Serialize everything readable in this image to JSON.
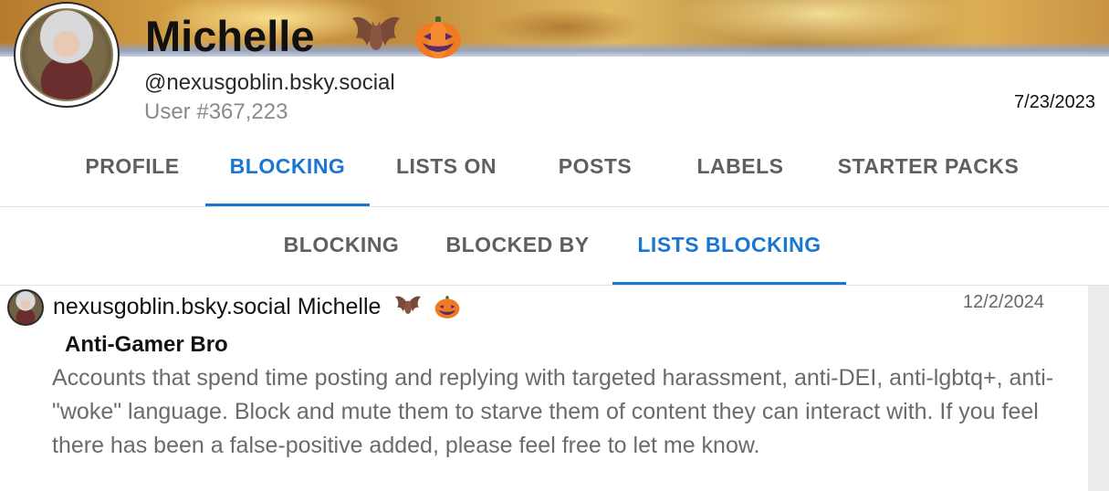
{
  "profile": {
    "display_name": "Michelle",
    "handle": "@nexusgoblin.bsky.social",
    "user_number": "User #367,223",
    "joined_date": "7/23/2023",
    "name_emojis": [
      "bat-emoji",
      "jack-o-lantern-emoji"
    ]
  },
  "main_tabs": [
    {
      "label": "PROFILE",
      "active": false
    },
    {
      "label": "BLOCKING",
      "active": true
    },
    {
      "label": "LISTS ON",
      "active": false
    },
    {
      "label": "POSTS",
      "active": false
    },
    {
      "label": "LABELS",
      "active": false
    },
    {
      "label": "STARTER PACKS",
      "active": false
    }
  ],
  "sub_tabs": [
    {
      "label": "BLOCKING",
      "active": false
    },
    {
      "label": "BLOCKED BY",
      "active": false
    },
    {
      "label": "LISTS BLOCKING",
      "active": true
    }
  ],
  "list_item": {
    "owner": "nexusgoblin.bsky.social Michelle",
    "date": "12/2/2024",
    "name": "Anti-Gamer Bro",
    "description": "Accounts that spend time posting and replying with targeted harassment, anti-DEI, anti-lgbtq+, anti-\"woke\" language. Block and mute them to starve them of content they can interact with. If you feel there has been a false-positive added, please feel free to let me know."
  },
  "colors": {
    "accent": "#1976d2",
    "tab_inactive": "#5f5f5f",
    "muted_text": "#6b6b6b"
  }
}
